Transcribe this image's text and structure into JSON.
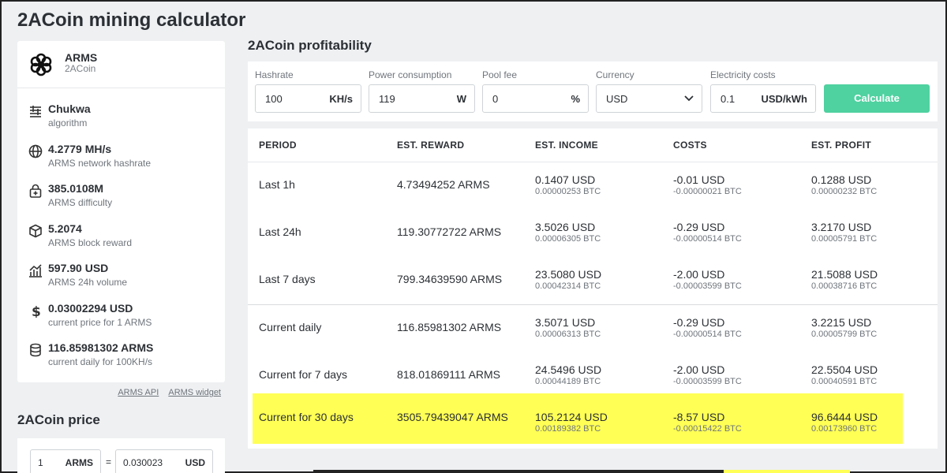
{
  "page_title": "2ACoin mining calculator",
  "coin": {
    "symbol": "ARMS",
    "name": "2ACoin"
  },
  "stats": [
    {
      "icon": "algorithm-icon",
      "value": "Chukwa",
      "label": "algorithm"
    },
    {
      "icon": "globe-icon",
      "value": "4.2779 MH/s",
      "label": "ARMS network hashrate"
    },
    {
      "icon": "difficulty-lock-icon",
      "value": "385.0108M",
      "label": "ARMS difficulty"
    },
    {
      "icon": "cube-icon",
      "value": "5.2074",
      "label": "ARMS block reward"
    },
    {
      "icon": "chart-icon",
      "value": "597.90 USD",
      "label": "ARMS 24h volume"
    },
    {
      "icon": "dollar-icon",
      "value": "0.03002294 USD",
      "label": "current price for 1 ARMS"
    },
    {
      "icon": "database-icon",
      "value": "116.85981302 ARMS",
      "label": "current daily for 100KH/s"
    }
  ],
  "links": {
    "api": "ARMS API",
    "widget": "ARMS widget"
  },
  "price": {
    "title": "2ACoin price",
    "amount": "1",
    "amount_unit": "ARMS",
    "equals": "=",
    "usd_value": "0.030023",
    "usd_unit": "USD"
  },
  "profitability": {
    "title": "2ACoin profitability",
    "hashrate": {
      "label": "Hashrate",
      "value": "100",
      "unit": "KH/s"
    },
    "power": {
      "label": "Power consumption",
      "value": "119",
      "unit": "W"
    },
    "pool_fee": {
      "label": "Pool fee",
      "value": "0",
      "unit": "%"
    },
    "currency": {
      "label": "Currency",
      "value": "USD"
    },
    "electricity": {
      "label": "Electricity costs",
      "value": "0.1",
      "unit": "USD/kWh"
    },
    "calculate_label": "Calculate"
  },
  "table": {
    "headers": [
      "PERIOD",
      "EST. REWARD",
      "EST. INCOME",
      "COSTS",
      "EST. PROFIT"
    ],
    "rows": [
      {
        "period": "Last 1h",
        "reward": "4.73494252 ARMS",
        "income": "0.1407 USD",
        "income_btc": "0.00000253 BTC",
        "costs": "-0.01 USD",
        "costs_btc": "-0.00000021 BTC",
        "profit": "0.1288 USD",
        "profit_btc": "0.00000232 BTC"
      },
      {
        "period": "Last 24h",
        "reward": "119.30772722 ARMS",
        "income": "3.5026 USD",
        "income_btc": "0.00006305 BTC",
        "costs": "-0.29 USD",
        "costs_btc": "-0.00000514 BTC",
        "profit": "3.2170 USD",
        "profit_btc": "0.00005791 BTC"
      },
      {
        "period": "Last 7 days",
        "reward": "799.34639590 ARMS",
        "income": "23.5080 USD",
        "income_btc": "0.00042314 BTC",
        "costs": "-2.00 USD",
        "costs_btc": "-0.00003599 BTC",
        "profit": "21.5088 USD",
        "profit_btc": "0.00038716 BTC"
      },
      {
        "period": "Current daily",
        "reward": "116.85981302 ARMS",
        "income": "3.5071 USD",
        "income_btc": "0.00006313 BTC",
        "costs": "-0.29 USD",
        "costs_btc": "-0.00000514 BTC",
        "profit": "3.2215 USD",
        "profit_btc": "0.00005799 BTC"
      },
      {
        "period": "Current for 7 days",
        "reward": "818.01869111 ARMS",
        "income": "24.5496 USD",
        "income_btc": "0.00044189 BTC",
        "costs": "-2.00 USD",
        "costs_btc": "-0.00003599 BTC",
        "profit": "22.5504 USD",
        "profit_btc": "0.00040591 BTC"
      },
      {
        "period": "Current for 30 days",
        "reward": "3505.79439047 ARMS",
        "income": "105.2124 USD",
        "income_btc": "0.00189382 BTC",
        "costs": "-8.57 USD",
        "costs_btc": "-0.00015422 BTC",
        "profit": "96.6444 USD",
        "profit_btc": "0.00173960 BTC"
      }
    ]
  },
  "colors": {
    "accent": "#4fd1a0",
    "highlight": "#ffff55"
  }
}
